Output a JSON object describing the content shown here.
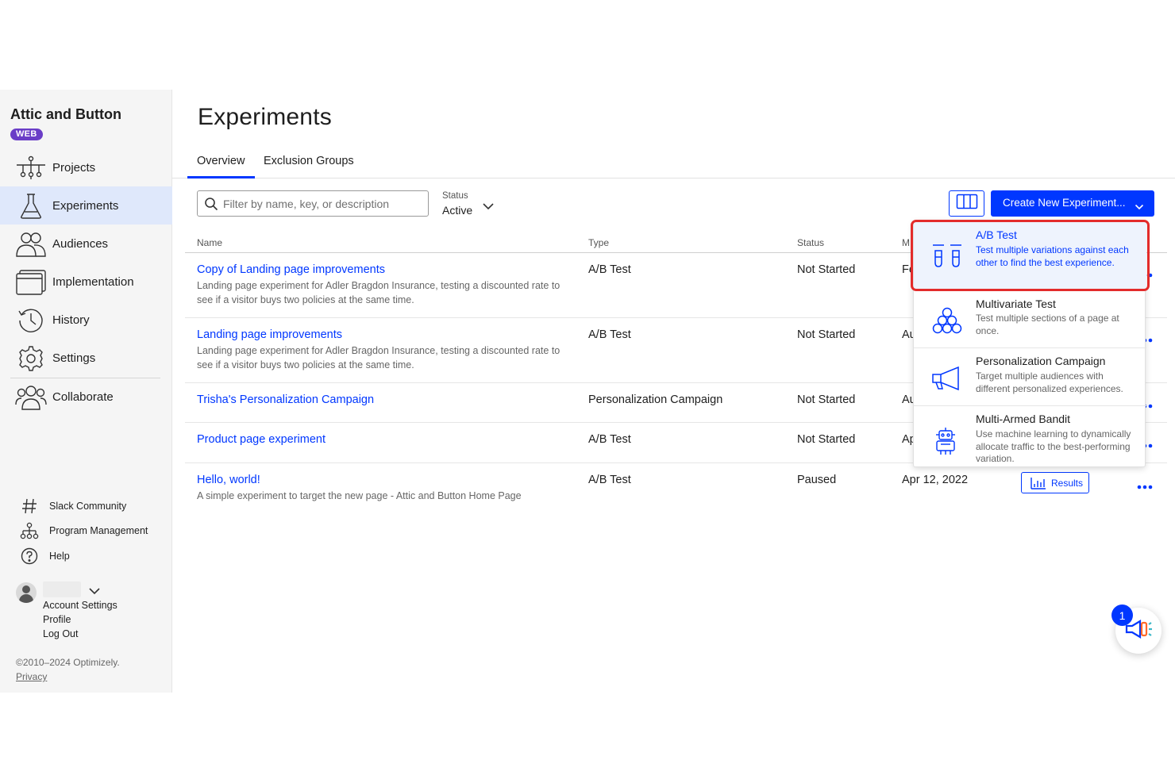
{
  "sidebar": {
    "brand": "Attic and Button",
    "badge": "WEB",
    "nav": [
      {
        "label": "Projects",
        "icon": "projects-icon"
      },
      {
        "label": "Experiments",
        "icon": "flask-icon",
        "active": true
      },
      {
        "label": "Audiences",
        "icon": "audiences-icon"
      },
      {
        "label": "Implementation",
        "icon": "implementation-icon"
      },
      {
        "label": "History",
        "icon": "history-icon"
      },
      {
        "label": "Settings",
        "icon": "gear-icon"
      },
      {
        "label": "Collaborate",
        "icon": "collaborate-icon"
      }
    ],
    "utilities": [
      {
        "label": "Slack Community",
        "icon": "hashtag-icon"
      },
      {
        "label": "Program Management",
        "icon": "org-chart-icon"
      },
      {
        "label": "Help",
        "icon": "help-icon"
      }
    ],
    "account": {
      "links": [
        "Account Settings",
        "Profile",
        "Log Out"
      ]
    },
    "copyright": "©2010–2024 Optimizely.",
    "privacy": "Privacy"
  },
  "main": {
    "title": "Experiments",
    "tabs": [
      {
        "label": "Overview",
        "active": true
      },
      {
        "label": "Exclusion Groups"
      }
    ],
    "search": {
      "placeholder": "Filter by name, key, or description",
      "value": ""
    },
    "status_filter": {
      "label": "Status",
      "value": "Active"
    },
    "create_button": "Create New Experiment...",
    "columns": {
      "name": "Name",
      "type": "Type",
      "status": "Status",
      "modified": "M"
    },
    "rows": [
      {
        "name": "Copy of Landing page improvements",
        "desc": "Landing page experiment for Adler Bragdon Insurance, testing a discounted rate to see if a visitor buys two policies at the same time.",
        "type": "A/B Test",
        "status": "Not Started",
        "modified": "Fe"
      },
      {
        "name": "Landing page improvements",
        "desc": "Landing page experiment for Adler Bragdon Insurance, testing a discounted rate to see if a visitor buys two policies at the same time.",
        "type": "A/B Test",
        "status": "Not Started",
        "modified": "Au"
      },
      {
        "name": "Trisha's Personalization Campaign",
        "desc": "",
        "type": "Personalization Campaign",
        "status": "Not Started",
        "modified": "Au"
      },
      {
        "name": "Product page experiment",
        "desc": "",
        "type": "A/B Test",
        "status": "Not Started",
        "modified": "Ap"
      },
      {
        "name": "Hello, world!",
        "desc": "A simple experiment to target the new page - Attic and Button Home Page",
        "type": "A/B Test",
        "status": "Paused",
        "modified": "Apr 12, 2022",
        "results": "Results"
      }
    ]
  },
  "create_menu": [
    {
      "title": "A/B Test",
      "desc": "Test multiple variations against each other to find the best experience.",
      "icon": "test-tubes-icon",
      "highlighted": true
    },
    {
      "title": "Multivariate Test",
      "desc": "Test multiple sections of a page at once.",
      "icon": "circles-icon"
    },
    {
      "title": "Personalization Campaign",
      "desc": "Target multiple audiences with different personalized experiences.",
      "icon": "megaphone-icon"
    },
    {
      "title": "Multi-Armed Bandit",
      "desc": "Use machine learning to dynamically allocate traffic to the best-performing variation.",
      "icon": "robot-icon"
    }
  ],
  "widget": {
    "badge": "1",
    "icon": "announcement-icon"
  },
  "colors": {
    "accent": "#0037ff",
    "highlight": "#e32b2b",
    "badge": "#6a3dc7"
  }
}
